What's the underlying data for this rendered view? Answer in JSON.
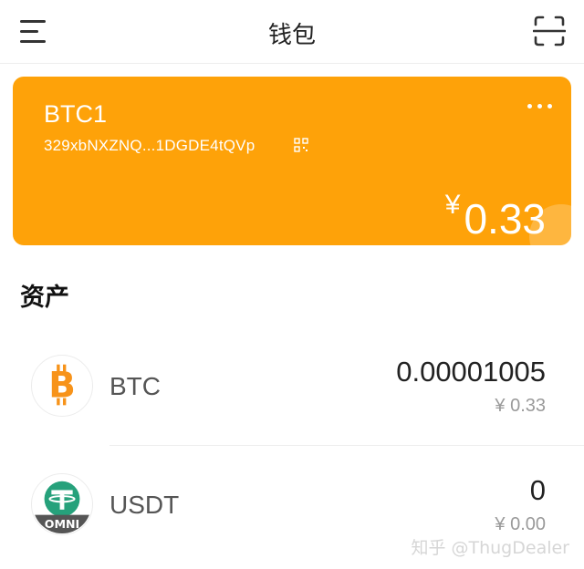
{
  "header": {
    "title": "钱包",
    "menu_icon": "menu-icon",
    "scan_icon": "scan-icon"
  },
  "wallet": {
    "name": "BTC1",
    "address": "329xbNXZNQ...1DGDE4tQVp",
    "currency_symbol": "¥",
    "balance": "0.33",
    "card_color": "#fea209"
  },
  "assets": {
    "title": "资产",
    "items": [
      {
        "symbol": "BTC",
        "amount": "0.00001005",
        "value": "¥ 0.33",
        "icon": "bitcoin-icon",
        "color": "#f7931a"
      },
      {
        "symbol": "USDT",
        "amount": "0",
        "value": "¥ 0.00",
        "icon": "tether-omni-icon",
        "badge": "OMNI",
        "color": "#26a17b"
      }
    ]
  },
  "watermark": "知乎 @ThugDealer"
}
